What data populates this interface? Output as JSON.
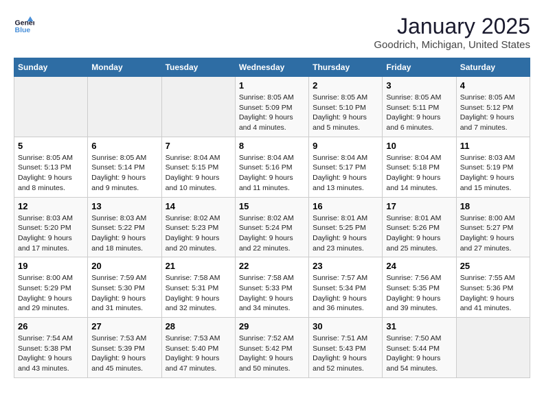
{
  "header": {
    "logo_line1": "General",
    "logo_line2": "Blue",
    "title": "January 2025",
    "subtitle": "Goodrich, Michigan, United States"
  },
  "weekdays": [
    "Sunday",
    "Monday",
    "Tuesday",
    "Wednesday",
    "Thursday",
    "Friday",
    "Saturday"
  ],
  "weeks": [
    [
      {
        "day": "",
        "info": ""
      },
      {
        "day": "",
        "info": ""
      },
      {
        "day": "",
        "info": ""
      },
      {
        "day": "1",
        "info": "Sunrise: 8:05 AM\nSunset: 5:09 PM\nDaylight: 9 hours\nand 4 minutes."
      },
      {
        "day": "2",
        "info": "Sunrise: 8:05 AM\nSunset: 5:10 PM\nDaylight: 9 hours\nand 5 minutes."
      },
      {
        "day": "3",
        "info": "Sunrise: 8:05 AM\nSunset: 5:11 PM\nDaylight: 9 hours\nand 6 minutes."
      },
      {
        "day": "4",
        "info": "Sunrise: 8:05 AM\nSunset: 5:12 PM\nDaylight: 9 hours\nand 7 minutes."
      }
    ],
    [
      {
        "day": "5",
        "info": "Sunrise: 8:05 AM\nSunset: 5:13 PM\nDaylight: 9 hours\nand 8 minutes."
      },
      {
        "day": "6",
        "info": "Sunrise: 8:05 AM\nSunset: 5:14 PM\nDaylight: 9 hours\nand 9 minutes."
      },
      {
        "day": "7",
        "info": "Sunrise: 8:04 AM\nSunset: 5:15 PM\nDaylight: 9 hours\nand 10 minutes."
      },
      {
        "day": "8",
        "info": "Sunrise: 8:04 AM\nSunset: 5:16 PM\nDaylight: 9 hours\nand 11 minutes."
      },
      {
        "day": "9",
        "info": "Sunrise: 8:04 AM\nSunset: 5:17 PM\nDaylight: 9 hours\nand 13 minutes."
      },
      {
        "day": "10",
        "info": "Sunrise: 8:04 AM\nSunset: 5:18 PM\nDaylight: 9 hours\nand 14 minutes."
      },
      {
        "day": "11",
        "info": "Sunrise: 8:03 AM\nSunset: 5:19 PM\nDaylight: 9 hours\nand 15 minutes."
      }
    ],
    [
      {
        "day": "12",
        "info": "Sunrise: 8:03 AM\nSunset: 5:20 PM\nDaylight: 9 hours\nand 17 minutes."
      },
      {
        "day": "13",
        "info": "Sunrise: 8:03 AM\nSunset: 5:22 PM\nDaylight: 9 hours\nand 18 minutes."
      },
      {
        "day": "14",
        "info": "Sunrise: 8:02 AM\nSunset: 5:23 PM\nDaylight: 9 hours\nand 20 minutes."
      },
      {
        "day": "15",
        "info": "Sunrise: 8:02 AM\nSunset: 5:24 PM\nDaylight: 9 hours\nand 22 minutes."
      },
      {
        "day": "16",
        "info": "Sunrise: 8:01 AM\nSunset: 5:25 PM\nDaylight: 9 hours\nand 23 minutes."
      },
      {
        "day": "17",
        "info": "Sunrise: 8:01 AM\nSunset: 5:26 PM\nDaylight: 9 hours\nand 25 minutes."
      },
      {
        "day": "18",
        "info": "Sunrise: 8:00 AM\nSunset: 5:27 PM\nDaylight: 9 hours\nand 27 minutes."
      }
    ],
    [
      {
        "day": "19",
        "info": "Sunrise: 8:00 AM\nSunset: 5:29 PM\nDaylight: 9 hours\nand 29 minutes."
      },
      {
        "day": "20",
        "info": "Sunrise: 7:59 AM\nSunset: 5:30 PM\nDaylight: 9 hours\nand 31 minutes."
      },
      {
        "day": "21",
        "info": "Sunrise: 7:58 AM\nSunset: 5:31 PM\nDaylight: 9 hours\nand 32 minutes."
      },
      {
        "day": "22",
        "info": "Sunrise: 7:58 AM\nSunset: 5:33 PM\nDaylight: 9 hours\nand 34 minutes."
      },
      {
        "day": "23",
        "info": "Sunrise: 7:57 AM\nSunset: 5:34 PM\nDaylight: 9 hours\nand 36 minutes."
      },
      {
        "day": "24",
        "info": "Sunrise: 7:56 AM\nSunset: 5:35 PM\nDaylight: 9 hours\nand 39 minutes."
      },
      {
        "day": "25",
        "info": "Sunrise: 7:55 AM\nSunset: 5:36 PM\nDaylight: 9 hours\nand 41 minutes."
      }
    ],
    [
      {
        "day": "26",
        "info": "Sunrise: 7:54 AM\nSunset: 5:38 PM\nDaylight: 9 hours\nand 43 minutes."
      },
      {
        "day": "27",
        "info": "Sunrise: 7:53 AM\nSunset: 5:39 PM\nDaylight: 9 hours\nand 45 minutes."
      },
      {
        "day": "28",
        "info": "Sunrise: 7:53 AM\nSunset: 5:40 PM\nDaylight: 9 hours\nand 47 minutes."
      },
      {
        "day": "29",
        "info": "Sunrise: 7:52 AM\nSunset: 5:42 PM\nDaylight: 9 hours\nand 50 minutes."
      },
      {
        "day": "30",
        "info": "Sunrise: 7:51 AM\nSunset: 5:43 PM\nDaylight: 9 hours\nand 52 minutes."
      },
      {
        "day": "31",
        "info": "Sunrise: 7:50 AM\nSunset: 5:44 PM\nDaylight: 9 hours\nand 54 minutes."
      },
      {
        "day": "",
        "info": ""
      }
    ]
  ]
}
